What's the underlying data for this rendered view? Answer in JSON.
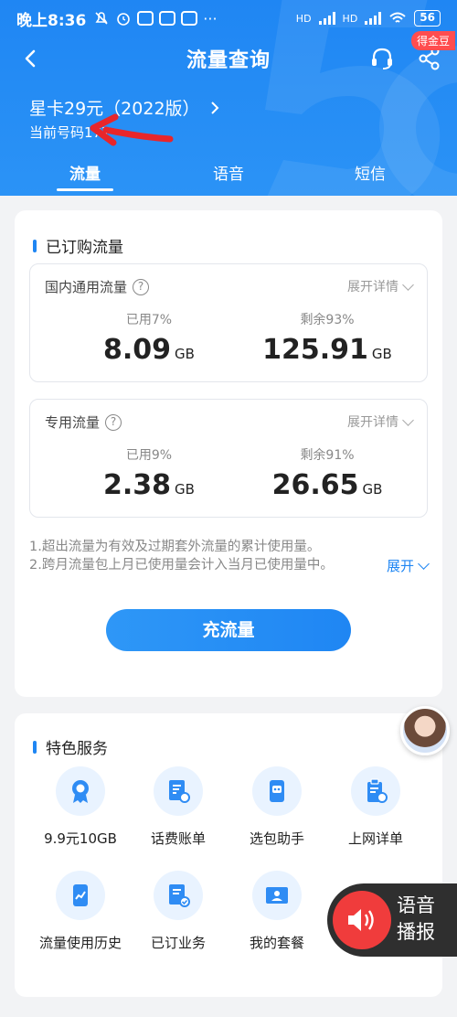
{
  "status_bar": {
    "time": "晚上8:36",
    "battery": "56",
    "network_left": "HD",
    "network_right": "HD"
  },
  "header": {
    "title": "流量查询",
    "badge": "得金豆",
    "plan_name": "星卡29元（2022版）",
    "phone_label": "当前号码177",
    "tabs": [
      "流量",
      "语音",
      "短信"
    ],
    "active_tab": 0
  },
  "subscribed": {
    "section_title": "已订购流量",
    "domestic": {
      "name": "国内通用流量",
      "expand": "展开详情",
      "used_label": "已用7%",
      "used_value": "8.09",
      "remain_label": "剩余93%",
      "remain_value": "125.91",
      "unit": "GB"
    },
    "special": {
      "name": "专用流量",
      "expand": "展开详情",
      "used_label": "已用9%",
      "used_value": "2.38",
      "remain_label": "剩余91%",
      "remain_value": "26.65",
      "unit": "GB"
    },
    "note1": "1.超出流量为有效及过期套外流量的累计使用量。",
    "note2": "2.跨月流量包上月已使用量会计入当月已使用量中。",
    "note_expand": "展开",
    "recharge": "充流量"
  },
  "services": {
    "section_title": "特色服务",
    "items": [
      {
        "label": "9.9元10GB",
        "icon": "medal-icon"
      },
      {
        "label": "话费账单",
        "icon": "bill-icon"
      },
      {
        "label": "选包助手",
        "icon": "robot-icon"
      },
      {
        "label": "上网详单",
        "icon": "clipboard-icon"
      },
      {
        "label": "流量使用历史",
        "icon": "chart-phone-icon"
      },
      {
        "label": "已订业务",
        "icon": "doc-check-icon"
      },
      {
        "label": "我的套餐",
        "icon": "id-card-icon"
      }
    ]
  },
  "voice_broadcast": {
    "label1": "语音",
    "label2": "播报"
  },
  "colors": {
    "primary": "#1f86f3",
    "badge": "#ff4d4f",
    "voice_button": "#f03c3c"
  }
}
